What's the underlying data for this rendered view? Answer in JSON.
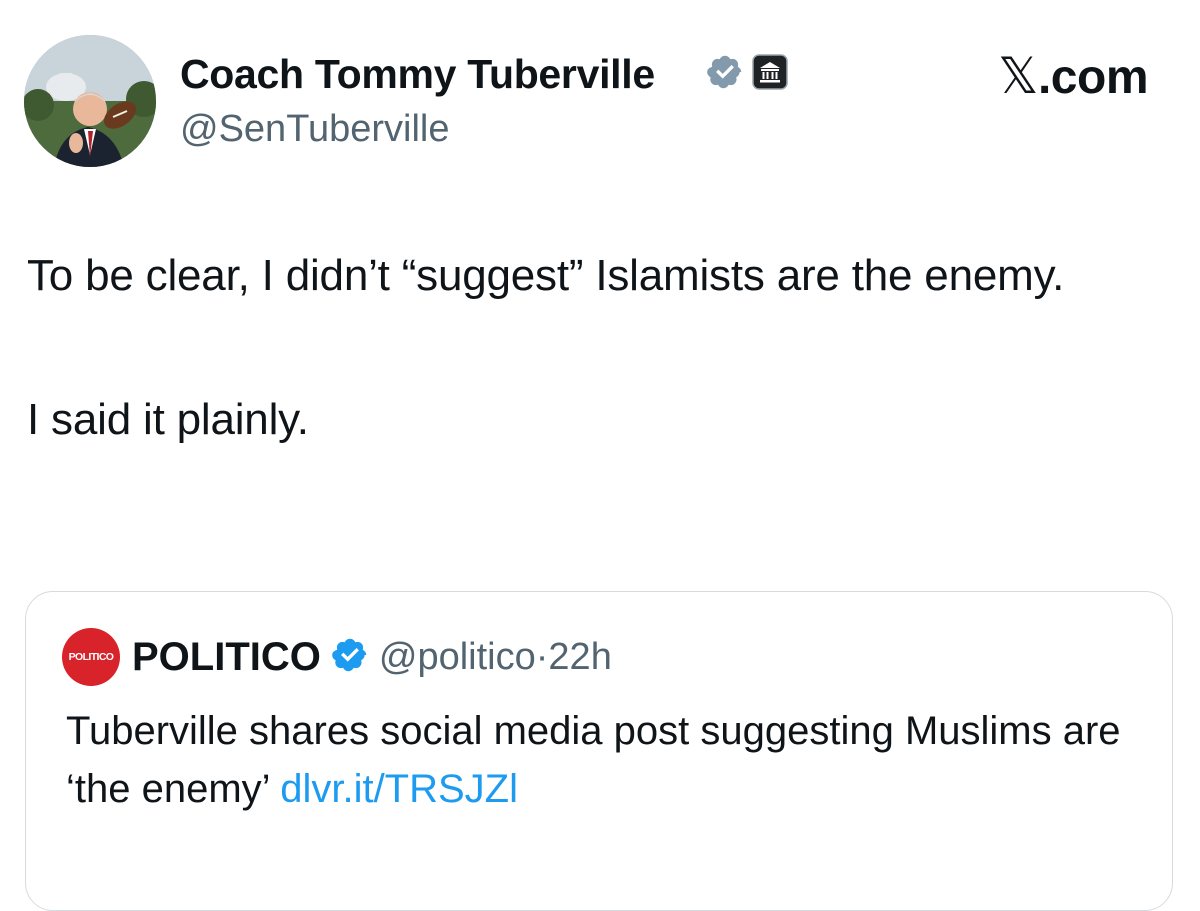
{
  "author": {
    "display_name": "Coach Tommy Tuberville",
    "handle": "@SenTuberville",
    "verified_badge_icon": "verified-badge-icon",
    "affiliation_badge_icon": "government-building-icon",
    "avatar_icon": "profile-photo"
  },
  "brand": {
    "label": "𝕏.com",
    "x_glyph": "𝕏",
    "suffix": ".com"
  },
  "tweet": {
    "paragraphs": [
      "To be clear, I didn’t “suggest” Islamists are the enemy.",
      "I said it plainly."
    ]
  },
  "quoted_tweet": {
    "avatar_text": "POLITICO",
    "display_name": "POLITICO",
    "handle": "@politico",
    "separator": "·",
    "time": "22h",
    "text": "Tuberville shares social media post suggesting Muslims are ‘the enemy’",
    "link": "dlvr.it/TRSJZl"
  },
  "colors": {
    "text": "#0f1419",
    "secondary_text": "#536471",
    "link": "#1d9bf0",
    "verified_gov": "#829aab",
    "verified_blue": "#1d9bf0",
    "politico_red": "#d8232a",
    "card_border": "#d6dbe0"
  }
}
